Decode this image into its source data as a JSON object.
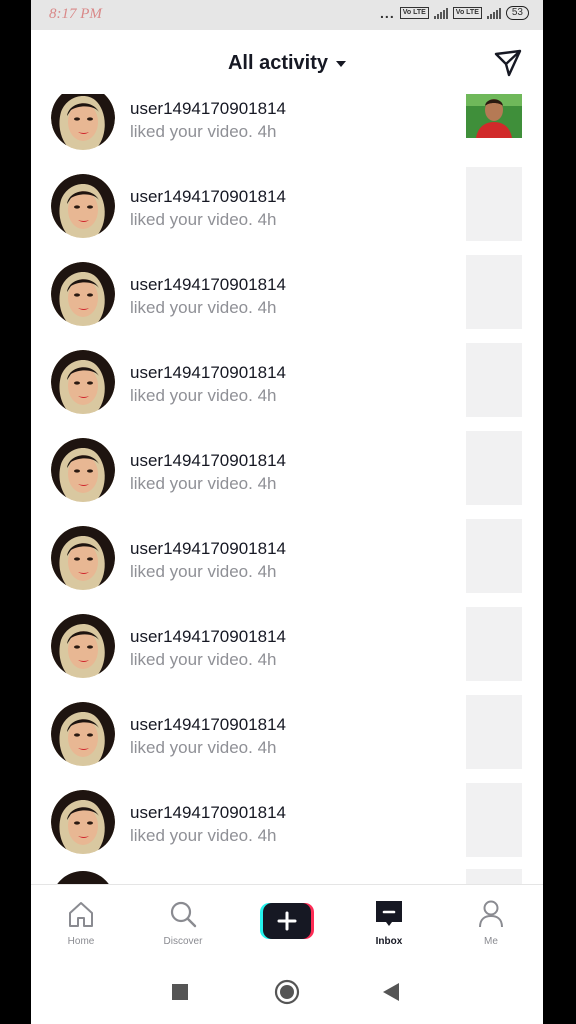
{
  "status_bar": {
    "time": "8:17 PM",
    "dots": "...",
    "volte_1": "Vo LTE",
    "volte_2": "Vo LTE",
    "battery": "53"
  },
  "header": {
    "title": "All activity",
    "title_icon": "caret-down-icon",
    "action_icon": "send-icon"
  },
  "activities": [
    {
      "username": "user1494170901814",
      "action": "liked your video.",
      "time": "4h",
      "has_preview": true
    },
    {
      "username": "user1494170901814",
      "action": "liked your video.",
      "time": "4h",
      "has_preview": false
    },
    {
      "username": "user1494170901814",
      "action": "liked your video.",
      "time": "4h",
      "has_preview": false
    },
    {
      "username": "user1494170901814",
      "action": "liked your video.",
      "time": "4h",
      "has_preview": false
    },
    {
      "username": "user1494170901814",
      "action": "liked your video.",
      "time": "4h",
      "has_preview": false
    },
    {
      "username": "user1494170901814",
      "action": "liked your video.",
      "time": "4h",
      "has_preview": false
    },
    {
      "username": "user1494170901814",
      "action": "liked your video.",
      "time": "4h",
      "has_preview": false
    },
    {
      "username": "user1494170901814",
      "action": "liked your video.",
      "time": "4h",
      "has_preview": false
    },
    {
      "username": "user1494170901814",
      "action": "liked your video.",
      "time": "4h",
      "has_preview": false
    }
  ],
  "bottom_nav": [
    {
      "label": "Home",
      "icon": "home-icon",
      "active": false
    },
    {
      "label": "Discover",
      "icon": "search-icon",
      "active": false
    },
    {
      "label": "",
      "icon": "plus-icon",
      "active": false
    },
    {
      "label": "Inbox",
      "icon": "inbox-icon",
      "active": true
    },
    {
      "label": "Me",
      "icon": "person-icon",
      "active": false
    }
  ],
  "system_nav": [
    "recents-square-icon",
    "home-circle-icon",
    "back-triangle-icon"
  ],
  "colors": {
    "text_primary": "#161823",
    "text_secondary": "#8f9096",
    "placeholder": "#f1f1f2",
    "accent_cyan": "#25f4ee",
    "accent_red": "#fe2c55"
  }
}
